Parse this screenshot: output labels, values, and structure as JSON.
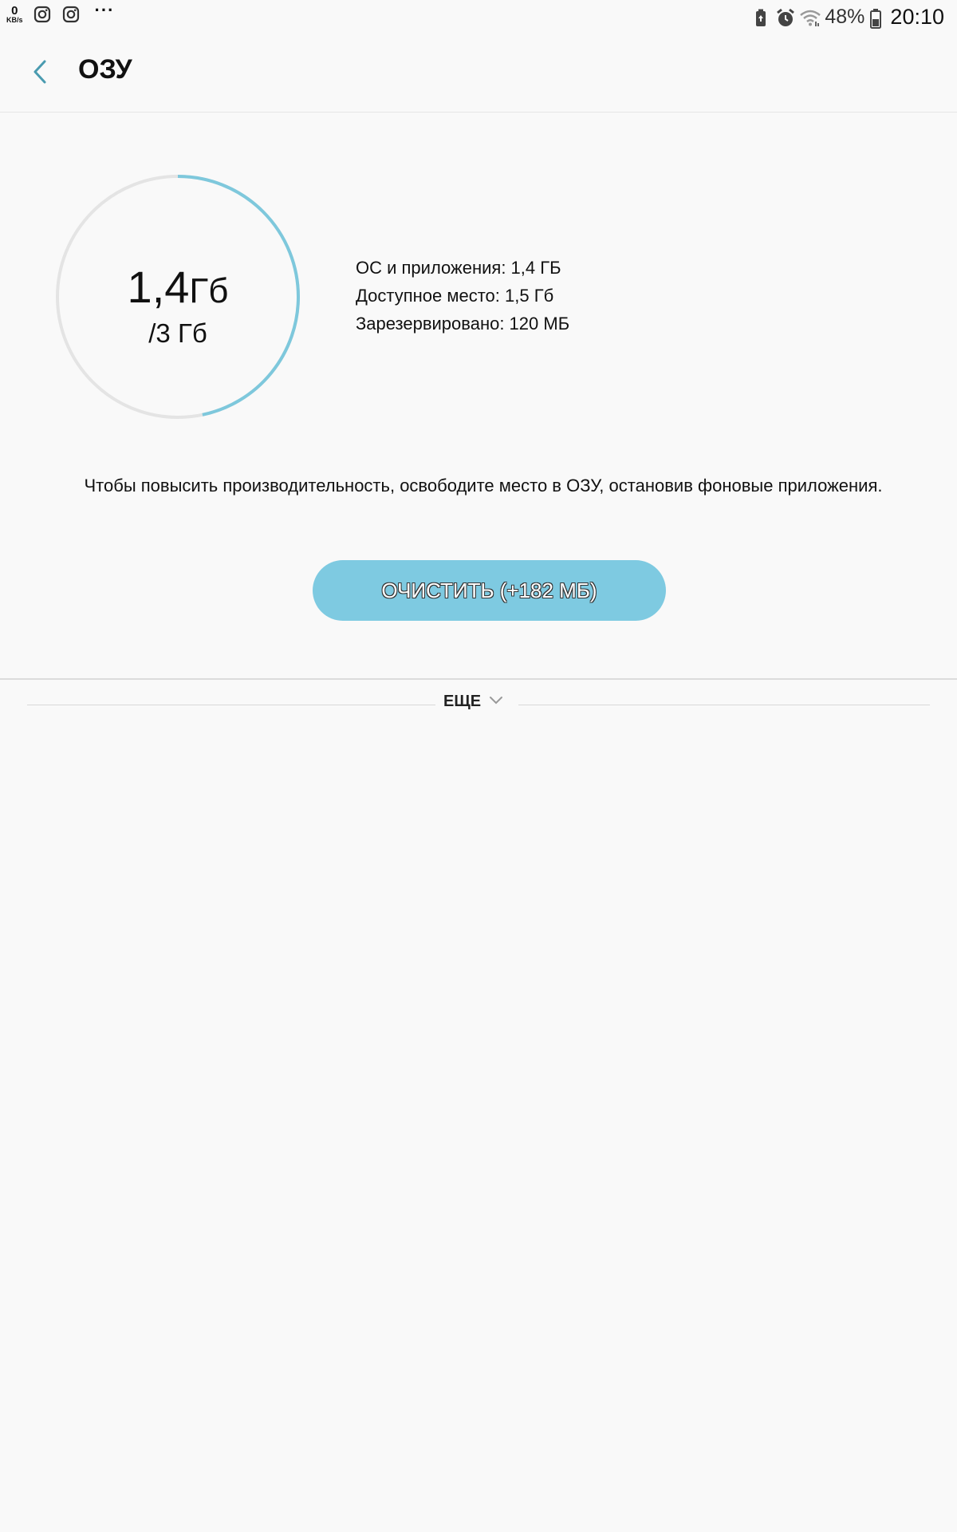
{
  "status_bar": {
    "net_speed_value": "0",
    "net_speed_unit": "KB/s",
    "notification_icons": [
      "instagram-icon",
      "instagram-icon"
    ],
    "overflow": "···",
    "right_icons": [
      "battery-saver-icon",
      "alarm-icon",
      "wifi-icon",
      "battery-icon"
    ],
    "battery_percent": "48%",
    "time": "20:10"
  },
  "header": {
    "title": "ОЗУ"
  },
  "gauge": {
    "used_value": "1,4",
    "used_unit": "Гб",
    "total": "/3 Гб",
    "fraction_used": 0.467,
    "track_color": "#e4e4e4",
    "fill_color": "#7ec8dc"
  },
  "info": {
    "os_apps": "ОС и приложения: 1,4 ГБ",
    "available": "Доступное место: 1,5 Гб",
    "reserved": "Зарезервировано: 120 МБ"
  },
  "hint": "Чтобы повысить производительность, освободите место в ОЗУ, остановив фоновые приложения.",
  "clear_button": {
    "label": "ОЧИСТИТЬ (+182 МБ)",
    "color": "#7ecae1"
  },
  "more": {
    "label": "ЕЩЕ"
  }
}
